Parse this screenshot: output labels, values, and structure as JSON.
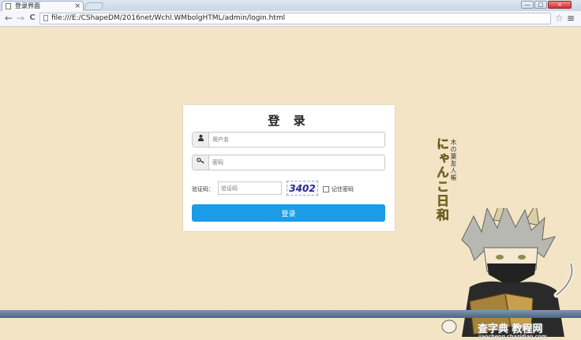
{
  "browser": {
    "tab_title": "登录界面",
    "tab_close": "×",
    "url": "file:///E:/CShapeDM/2016net/Wchl.WMbolgHTML/admin/login.html",
    "back_icon": "←",
    "forward_icon": "→",
    "reload_icon": "C",
    "star_icon": "☆",
    "menu_icon": "≡",
    "window_controls": [
      "—",
      "□",
      "×"
    ]
  },
  "login": {
    "title": "登 录",
    "username_placeholder": "用户名",
    "password_placeholder": "密码",
    "user_icon": "👤",
    "key_icon": "🔑",
    "captcha_label": "验证码：",
    "captcha_placeholder": "验证码",
    "captcha_code": "3402",
    "remember_label": "记住密码",
    "submit_label": "登录"
  },
  "decoration": {
    "vertical_caption": "木の葉友人帳",
    "vertical_title": "にゃんこ日和"
  },
  "watermark": {
    "main": "查字典 教程网",
    "sub": "jiaocheng.chazidian.com"
  },
  "colors": {
    "page_background": "#f3e4c6",
    "button": "#1c9be6"
  }
}
